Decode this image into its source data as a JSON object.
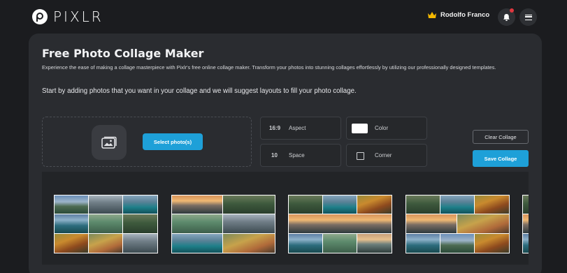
{
  "header": {
    "logo_text": "PIXLR",
    "user_name": "Rodolfo Franco",
    "crown_color": "#f5b800",
    "notification_dot_color": "#e0373f",
    "icons": [
      "bell-icon",
      "menu-icon",
      "crown-icon"
    ]
  },
  "main": {
    "title": "Free Photo Collage Maker",
    "description": "Experience the ease of making a collage masterpiece with Pixlr's free online collage maker. Transform your photos into stunning collages effortlessly by utilizing our professionally designed templates.",
    "instruction": "Start by adding photos that you want in your collage and we will suggest layouts to fill your photo collage."
  },
  "upload": {
    "select_button_label": "Select photo(s)",
    "icon": "image-icon"
  },
  "options": {
    "aspect": {
      "value": "16:9",
      "label": "Aspect"
    },
    "color": {
      "label": "Color",
      "value_color": "#ffffff"
    },
    "space": {
      "value": "10",
      "label": "Space"
    },
    "corner": {
      "label": "Corner"
    }
  },
  "actions": {
    "clear_label": "Clear Collage",
    "save_label": "Save Collage"
  },
  "colors": {
    "accent": "#1ea0d8",
    "background": "#1b1c1f",
    "panel": "#2a2c30"
  }
}
